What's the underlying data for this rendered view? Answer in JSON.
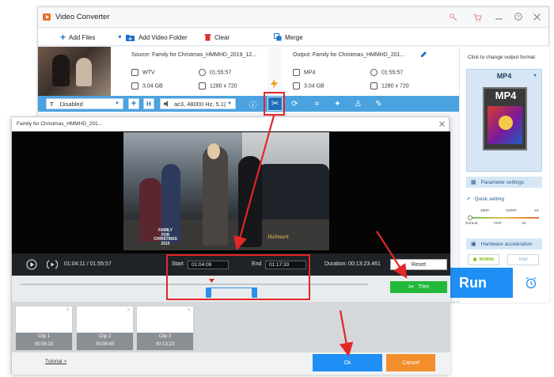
{
  "window": {
    "title": "Video Converter",
    "colors": {
      "accent": "#4aa3e0",
      "run": "#1e8ff5",
      "trim": "#22b83a",
      "cancel": "#f28e2b",
      "annotation": "#e32626"
    }
  },
  "toolbar": {
    "add_files": "Add Files",
    "add_video_folder": "Add Video Folder",
    "clear": "Clear",
    "merge": "Merge"
  },
  "file": {
    "source_label": "Source: Family for Christmas_HMMHD_2019_12...",
    "output_label": "Output: Family for Christmas_HMMHD_201...",
    "source_format": "WTV",
    "source_duration": "01:55:57",
    "source_size": "3.04 GB",
    "source_resolution": "1280 x 720",
    "output_format": "MP4",
    "output_duration": "01:55:57",
    "output_size": "3.04 GB",
    "output_resolution": "1280 x 720"
  },
  "editbar": {
    "subtitle_select": "Disabled",
    "audio_select": "ac3, 48000 Hz, 5.1("
  },
  "right_panel": {
    "change_format_label": "Click to change output format:",
    "format": "MP4",
    "format_tile_text": "MP4",
    "parameter_settings": "Parameter settings",
    "quick_setting": "Quick setting",
    "ticks_top": [
      "480P",
      "1080P",
      "4K"
    ],
    "ticks_bottom": [
      "Default",
      "720P",
      "2K"
    ],
    "hardware_acceleration": "Hardware acceleration",
    "nvidia": "NVIDIA",
    "intel": "Intel"
  },
  "dialog": {
    "title": "Family for Christmas_HMMHD_201...",
    "video_caption": [
      "FAMILY",
      "FOR",
      "CHRISTMAS",
      "2015"
    ],
    "video_logo": "Hallmark",
    "current_time": "01:04:11",
    "separator": "/",
    "total_time": "01:55:57",
    "start_label": "Start",
    "start_value": "01:04:09",
    "end_label": "End",
    "end_value": "01:17:33",
    "duration_label": "Duration:",
    "duration_value": "00:13:23.461",
    "reset": "Reset",
    "trim": "Trim",
    "clips": [
      {
        "name": "Clip 1",
        "duration": "00:06:10"
      },
      {
        "name": "Clip 2",
        "duration": "00:08:40"
      },
      {
        "name": "Clip 3",
        "duration": "00:13:23"
      }
    ],
    "tutorial": "Tutorial >",
    "ok": "Ok",
    "cancel": "Cancel"
  },
  "run": {
    "label": "Run"
  }
}
